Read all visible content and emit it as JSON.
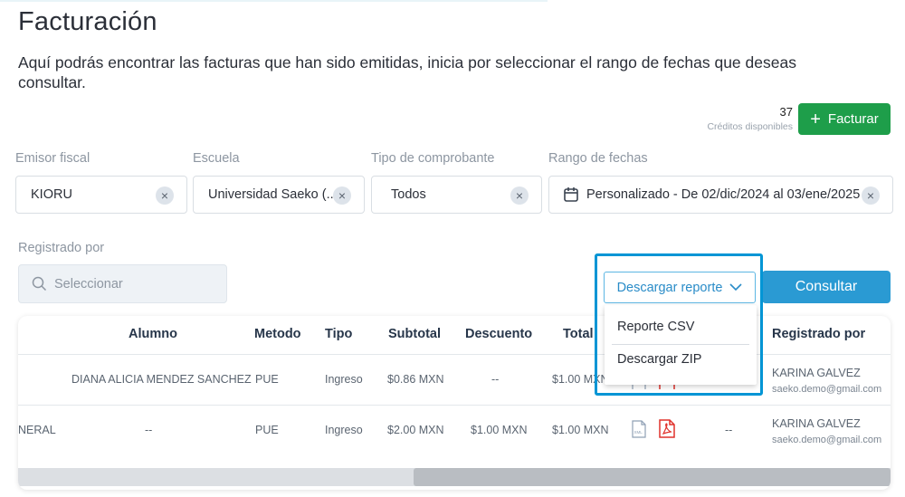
{
  "page": {
    "title": "Facturación",
    "description": "Aquí podrás encontrar las facturas que han sido emitidas, inicia por seleccionar el rango de fechas que deseas consultar."
  },
  "credits": {
    "count": "37",
    "label": "Créditos disponibles"
  },
  "facturar_button": {
    "label": "Facturar",
    "icon": "plus-icon"
  },
  "filters": {
    "emisor": {
      "label": "Emisor fiscal",
      "value": "KIORU"
    },
    "escuela": {
      "label": "Escuela",
      "value": "Universidad Saeko (..."
    },
    "tipo": {
      "label": "Tipo de comprobante",
      "value": "Todos"
    },
    "rango": {
      "label": "Rango de fechas",
      "value": "Personalizado - De 02/dic/2024 al 03/ene/2025",
      "icon": "calendar-icon"
    },
    "registrado": {
      "label": "Registrado por",
      "placeholder": "Seleccionar",
      "icon": "search-icon"
    }
  },
  "clear_glyph": "×",
  "descargar": {
    "label": "Descargar reporte",
    "options": [
      "Reporte CSV",
      "Descargar ZIP"
    ]
  },
  "consultar_label": "Consultar",
  "table": {
    "headers": {
      "alumno": "Alumno",
      "metodo": "Metodo",
      "tipo": "Tipo",
      "subtotal": "Subtotal",
      "descuento": "Descuento",
      "total": "Total",
      "registrado": "Registrado por"
    },
    "rows": [
      {
        "first": "",
        "alumno": "DIANA ALICIA MENDEZ SANCHEZ",
        "metodo": "PUE",
        "tipo": "Ingreso",
        "subtotal": "$0.86 MXN",
        "descuento": "--",
        "total": "$1.00 MXN",
        "extra": "",
        "registrado_name": "KARINA GALVEZ",
        "registrado_email": "saeko.demo@gmail.com"
      },
      {
        "first": "NERAL",
        "alumno": "--",
        "metodo": "PUE",
        "tipo": "Ingreso",
        "subtotal": "$2.00 MXN",
        "descuento": "$1.00 MXN",
        "total": "$1.00 MXN",
        "extra": "--",
        "registrado_name": "KARINA GALVEZ",
        "registrado_email": "saeko.demo@gmail.com"
      }
    ]
  },
  "colors": {
    "primary_green": "#1e9e4a",
    "primary_blue": "#2a9ad3",
    "highlight_border": "#0095d5",
    "pdf_red": "#e0322c"
  }
}
